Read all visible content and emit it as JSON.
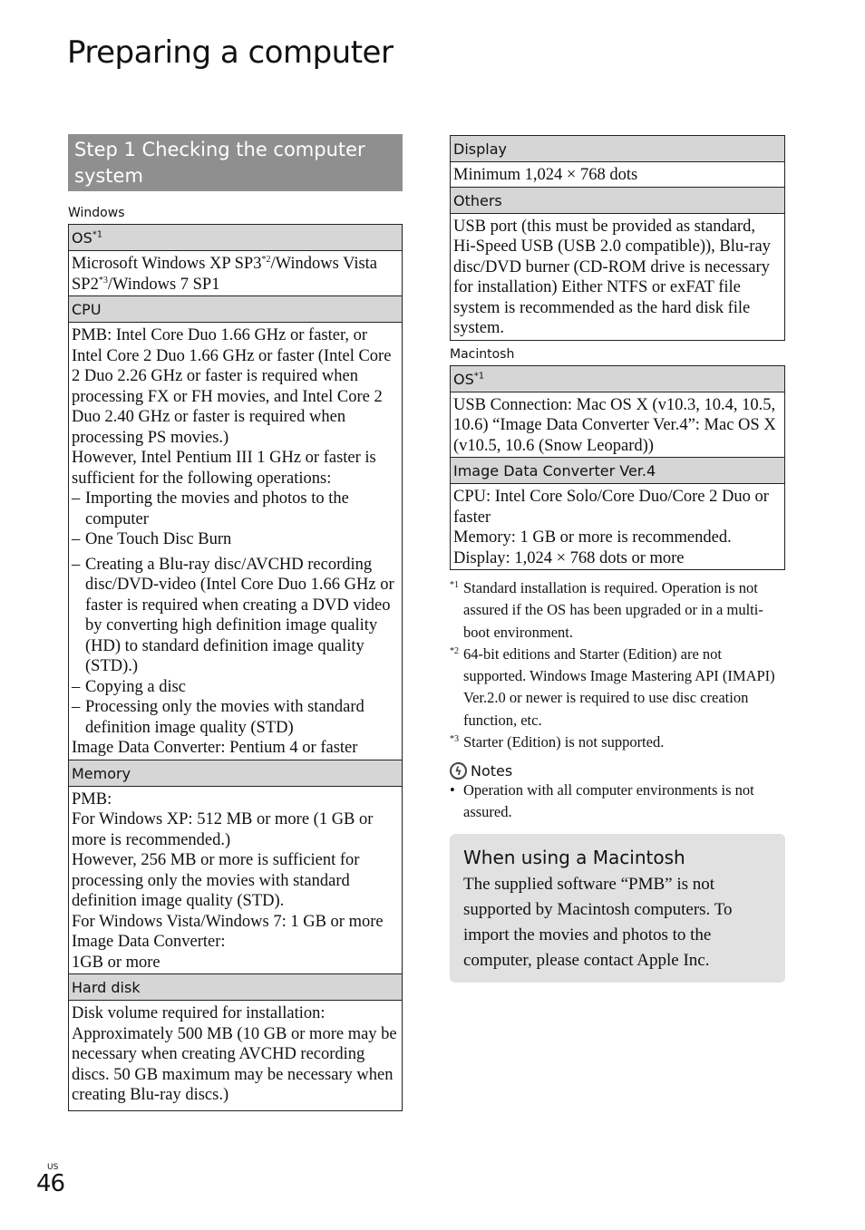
{
  "page": {
    "title": "Preparing a computer",
    "page_region": "US",
    "page_number": "46"
  },
  "step": {
    "heading": "Step 1 Checking the computer system"
  },
  "windows": {
    "label": "Windows",
    "os": {
      "header": "OS",
      "header_note": "*1",
      "value_parts": [
        "Microsoft Windows XP SP3",
        "*2",
        "/Windows Vista SP2",
        "*3",
        "/Windows 7 SP1"
      ]
    },
    "cpu": {
      "header": "CPU",
      "intro": "PMB: Intel Core Duo 1.66 GHz or faster, or Intel Core 2 Duo 1.66 GHz or faster (Intel Core 2 Duo 2.26 GHz or faster is required when processing FX or FH movies, and Intel Core 2 Duo 2.40 GHz or faster is required when processing PS movies.)",
      "however": "However, Intel Pentium III 1 GHz or faster is sufficient for the following operations:",
      "dash": "–",
      "operations": [
        "Importing the movies and photos to the computer",
        "One Touch Disc Burn",
        "Creating a Blu-ray disc/AVCHD recording disc/DVD-video (Intel Core Duo 1.66 GHz or faster is required when creating a DVD video by converting high definition image quality (HD) to standard definition image quality (STD).)",
        "Copying a disc",
        "Processing only the movies with standard definition image quality (STD)"
      ],
      "idc": "Image Data Converter: Pentium 4 or faster"
    },
    "memory": {
      "header": "Memory",
      "lines": [
        "PMB:",
        "For Windows XP: 512 MB or more (1 GB or more is recommended.)",
        "However, 256 MB or more is sufficient for processing only the movies with standard definition image quality (STD).",
        "For Windows Vista/Windows 7: 1 GB or more",
        "Image Data Converter:",
        "1GB or more"
      ]
    },
    "hard_disk": {
      "header": "Hard disk",
      "value": "Disk volume required for installation: Approximately 500 MB (10 GB or more may be necessary when creating AVCHD recording discs. 50 GB maximum may be necessary when creating Blu-ray discs.)"
    }
  },
  "windows_cont": {
    "display": {
      "header": "Display",
      "value": "Minimum 1,024 × 768 dots"
    },
    "others": {
      "header": "Others",
      "value": "USB port (this must be provided as standard, Hi-Speed USB (USB 2.0 compatible)), Blu-ray disc/DVD burner (CD-ROM drive is necessary for installation) Either NTFS or exFAT file system is recommended as the hard disk file system."
    }
  },
  "macintosh": {
    "label": "Macintosh",
    "os": {
      "header": "OS",
      "header_note": "*1",
      "value": "USB Connection: Mac OS X (v10.3, 10.4, 10.5, 10.6) “Image Data Converter Ver.4”: Mac OS X (v10.5, 10.6 (Snow Leopard))"
    },
    "idc": {
      "header": "Image Data Converter Ver.4",
      "lines": [
        "CPU: Intel Core Solo/Core Duo/Core 2 Duo or faster",
        "Memory: 1 GB or more is recommended.",
        "Display: 1,024 × 768 dots or more"
      ]
    }
  },
  "footnotes": [
    {
      "mark": "*1",
      "text": "Standard installation is required. Operation is not assured if the OS has been upgraded or in a multi-boot environment."
    },
    {
      "mark": "*2",
      "text": "64-bit editions and Starter (Edition) are not supported. Windows Image Mastering API (IMAPI) Ver.2.0 or newer is required to use disc creation function, etc."
    },
    {
      "mark": "*3",
      "text": "Starter (Edition) is not supported."
    }
  ],
  "notes": {
    "icon": "notes-warning-icon",
    "icon_glyph": "ϟ",
    "title": "Notes",
    "bullet": "•",
    "items": [
      "Operation with all computer environments is not assured."
    ]
  },
  "mac_box": {
    "heading": "When using a Macintosh",
    "body": "The supplied software “PMB” is not supported by Macintosh computers. To import the movies and photos to the computer, please contact Apple Inc."
  }
}
